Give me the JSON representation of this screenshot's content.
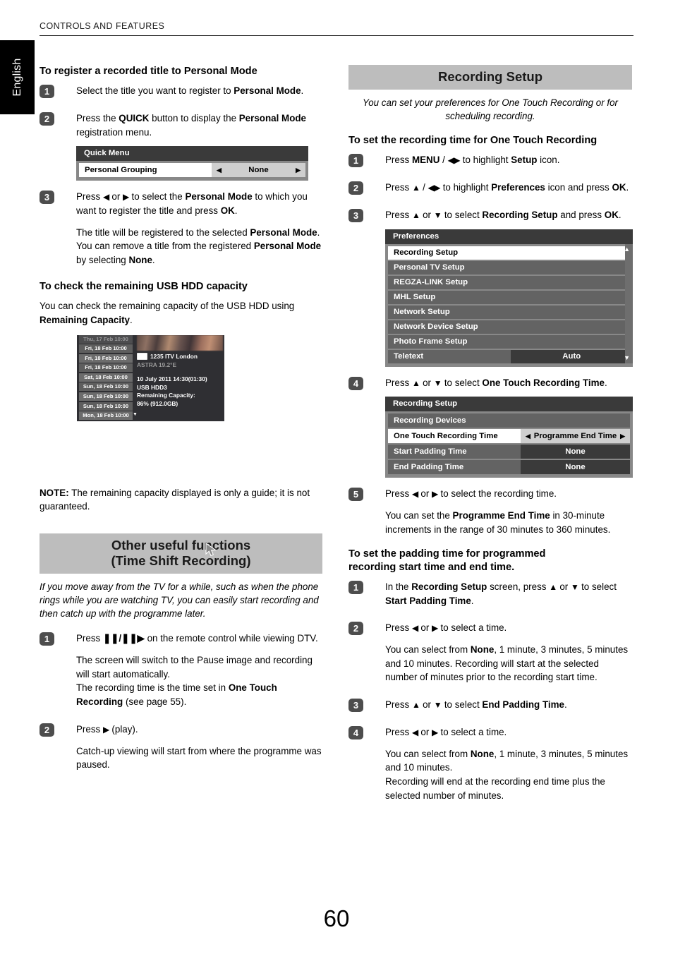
{
  "header": {
    "running_head": "CONTROLS AND FEATURES",
    "language_tab": "English"
  },
  "page_number": "60",
  "left_column": {
    "heading_register": "To register a recorded title to Personal Mode",
    "steps_register": [
      {
        "num": "1",
        "html": "Select the title you want to register to <b>Personal Mode</b>."
      },
      {
        "num": "2",
        "html": "Press the <b>QUICK</b> button to display the <b>Personal Mode</b> registration menu."
      },
      {
        "num": "3",
        "html": "Press <span class=\"glyph\">◀</span> or <span class=\"glyph\">▶</span> to select the <b>Personal Mode</b> to which you want to register the title and press <b>OK</b>."
      }
    ],
    "step3_notes": "The title will be registered to the selected <b>Personal Mode</b>.<br>You can remove a title from the registered <b>Personal Mode</b> by selecting <b>None</b>.",
    "quick_menu": {
      "title": "Quick Menu",
      "rows": [
        {
          "label": "Personal Grouping",
          "value": "None",
          "arrow_left": "◀",
          "arrow_right": "▶",
          "selected": true
        }
      ]
    },
    "heading_capacity": "To check the remaining USB HDD capacity",
    "capacity_intro": "You can check the remaining capacity of the USB HDD using <b>Remaining Capacity</b>.",
    "usb_shot": {
      "epg_times": [
        "Thu, 17 Feb 10:00",
        "Fri, 18 Feb 10:00",
        "Fri, 18 Feb 10:00",
        "Fri, 18 Feb 10:00",
        "Sat, 18 Feb 10:00",
        "Sun, 18 Feb 10:00",
        "Sun, 18 Feb 10:00",
        "Sun, 18 Feb 10:00",
        "Mon, 18 Feb 10:00"
      ],
      "channel": "1235 ITV London",
      "satellite": "ASTRA 19.2°E",
      "datetime": "10 July 2011  14:30(01:30)",
      "device": "USB HDD3",
      "capacity_label": "Remaining Capacity:",
      "capacity_value": "86% (912.0GB)",
      "scroll_down_glyph": "▼"
    },
    "note_html": "<b>NOTE:</b> The remaining capacity displayed is only a guide; it is not guaranteed.",
    "section_other": {
      "title_line1": "Other useful functions",
      "title_line2": "(Time Shift Recording)",
      "intro": "If you move away from the TV for a while, such as when the phone rings while you are watching TV, you can easily start recording and then catch up with the programme later.",
      "steps": [
        {
          "num": "1",
          "html": "Press <b>❚❚/❚❚▶</b> on the remote control while viewing DTV.",
          "notes": "The screen will switch to the Pause image and recording will start automatically.<br>The recording time is the time set in <b>One Touch Recording</b> (see page 55)."
        },
        {
          "num": "2",
          "html": "Press <span class=\"glyph\">▶</span> (play).",
          "notes": "Catch-up viewing will start from where the programme was paused."
        }
      ]
    }
  },
  "right_column": {
    "section_title": "Recording Setup",
    "section_intro": "You can set your preferences for One Touch Recording or for scheduling recording.",
    "heading_ottime": "To set the recording time for One Touch Recording",
    "steps_ottime": [
      {
        "num": "1",
        "html": "Press <b>MENU</b> / <span class=\"glyph\">◀▶</span> to highlight <b>Setup</b> icon."
      },
      {
        "num": "2",
        "html": "Press <span class=\"glyph\">▲</span> / <span class=\"glyph\">◀▶</span> to highlight <b>Preferences</b> icon and press <b>OK</b>."
      },
      {
        "num": "3",
        "html": "Press <span class=\"glyph\">▲</span> or <span class=\"glyph\">▼</span> to select <b>Recording Setup</b> and press <b>OK</b>."
      },
      {
        "num": "4",
        "html": "Press <span class=\"glyph\">▲</span> or <span class=\"glyph\">▼</span> to select <b>One Touch Recording Time</b>."
      },
      {
        "num": "5",
        "html": "Press <span class=\"glyph\">◀</span> or <span class=\"glyph\">▶</span> to select the recording time.",
        "notes": "You can set the <b>Programme End Time</b> in 30-minute increments in the range of 30 minutes to 360 minutes."
      }
    ],
    "preferences_menu": {
      "title": "Preferences",
      "rows": [
        {
          "label": "Recording Setup",
          "value": "",
          "selected": true
        },
        {
          "label": "Personal TV Setup",
          "value": "",
          "selected": false
        },
        {
          "label": "REGZA-LINK Setup",
          "value": "",
          "selected": false
        },
        {
          "label": "MHL Setup",
          "value": "",
          "selected": false
        },
        {
          "label": "Network Setup",
          "value": "",
          "selected": false
        },
        {
          "label": "Network Device Setup",
          "value": "",
          "selected": false
        },
        {
          "label": "Photo Frame Setup",
          "value": "",
          "selected": false
        },
        {
          "label": "Teletext",
          "value": "Auto",
          "selected": false
        }
      ],
      "scroll_up_glyph": "▲",
      "scroll_down_glyph": "▼"
    },
    "recording_setup_menu": {
      "title": "Recording Setup",
      "rows": [
        {
          "label": "Recording Devices",
          "value": "",
          "selected": false,
          "has_arrows": false
        },
        {
          "label": "One Touch Recording Time",
          "value": "Programme End Time",
          "selected": true,
          "has_arrows": true,
          "arrow_left": "◀",
          "arrow_right": "▶"
        },
        {
          "label": "Start Padding Time",
          "value": "None",
          "selected": false,
          "has_arrows": false
        },
        {
          "label": "End Padding Time",
          "value": "None",
          "selected": false,
          "has_arrows": false
        }
      ]
    },
    "heading_padding_l1": "To set the padding time for programmed",
    "heading_padding_l2": "recording start time and end time.",
    "steps_padding": [
      {
        "num": "1",
        "html": "In the <b>Recording Setup</b> screen, press <span class=\"glyph\">▲</span> or <span class=\"glyph\">▼</span> to select <b>Start Padding Time</b>."
      },
      {
        "num": "2",
        "html": "Press <span class=\"glyph\">◀</span> or <span class=\"glyph\">▶</span> to select a time.",
        "notes": "You can select from <b>None</b>, 1 minute, 3 minutes, 5 minutes and 10 minutes. Recording will start at the selected number of minutes prior to the recording start time."
      },
      {
        "num": "3",
        "html": "Press <span class=\"glyph\">▲</span> or <span class=\"glyph\">▼</span> to select <b>End Padding Time</b>."
      },
      {
        "num": "4",
        "html": "Press <span class=\"glyph\">◀</span> or <span class=\"glyph\">▶</span> to select a time.",
        "notes": "You can select from <b>None</b>, 1 minute, 3 minutes, 5 minutes and 10 minutes.<br>Recording will end at the recording end time plus the selected number of minutes."
      }
    ]
  }
}
